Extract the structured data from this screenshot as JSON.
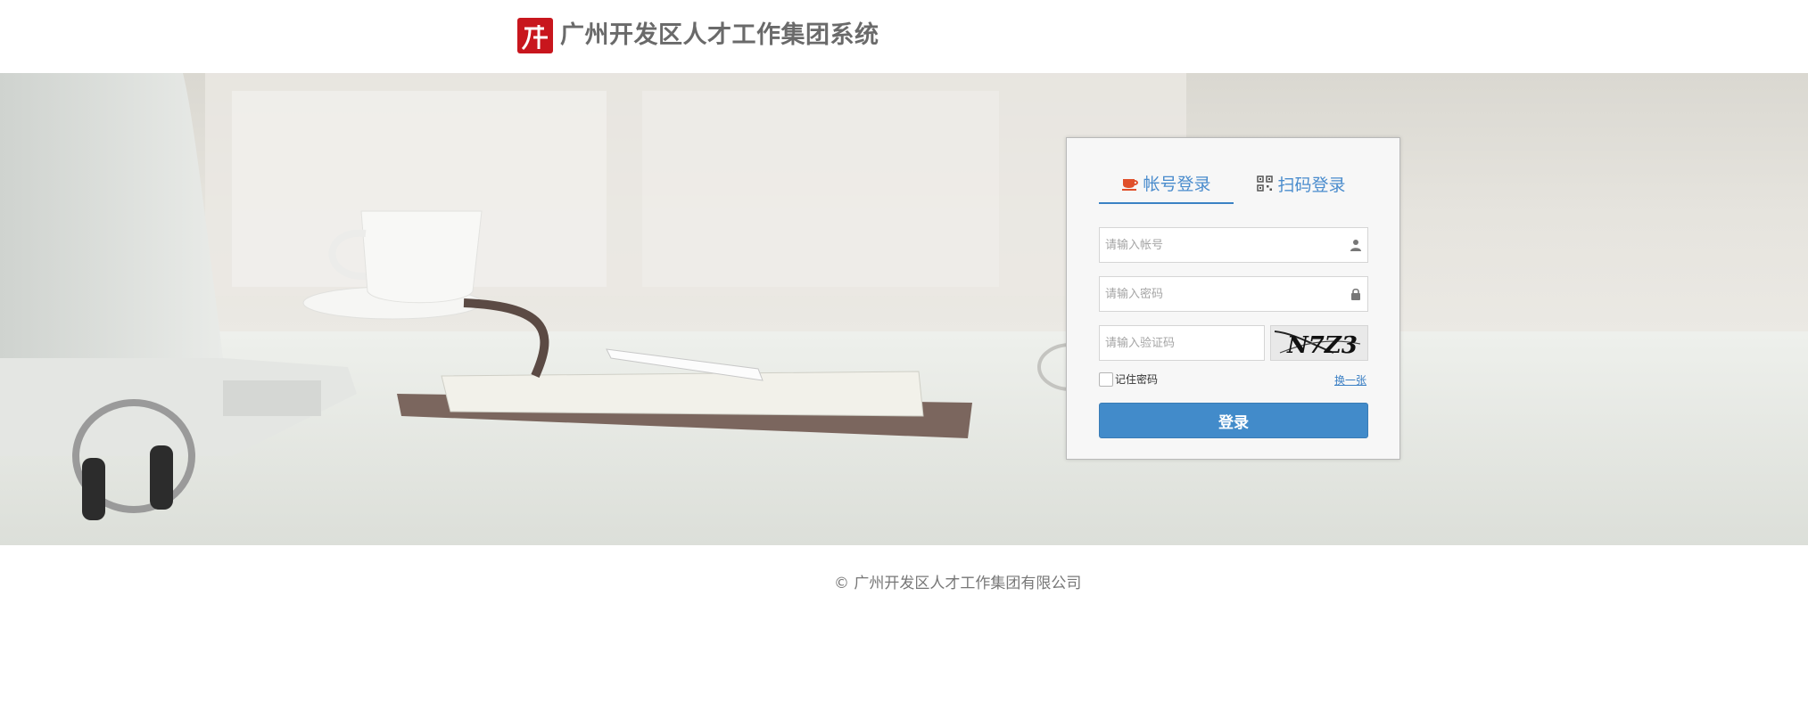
{
  "header": {
    "title": "广州开发区人才工作集团系统",
    "logo": {
      "icon": "company-logo",
      "color": "#c8161d"
    }
  },
  "login": {
    "tabs": [
      {
        "label": "帐号登录",
        "icon": "coffee-cup-icon",
        "active": true
      },
      {
        "label": "扫码登录",
        "icon": "qrcode-icon",
        "active": false
      }
    ],
    "username": {
      "placeholder": "请输入帐号",
      "value": "",
      "icon": "user-icon"
    },
    "password": {
      "placeholder": "请输入密码",
      "value": "",
      "icon": "lock-icon"
    },
    "captcha": {
      "placeholder": "请输入验证码",
      "value": "",
      "image_text": "N7Z3"
    },
    "remember_label": "记住密码",
    "remember_checked": false,
    "refresh_label": "换一张",
    "submit_label": "登录"
  },
  "footer": {
    "copyright": "© 广州开发区人才工作集团有限公司"
  },
  "colors": {
    "accent": "#428bca",
    "tab_text": "#4a8ccd",
    "brand_red": "#c8161d"
  }
}
